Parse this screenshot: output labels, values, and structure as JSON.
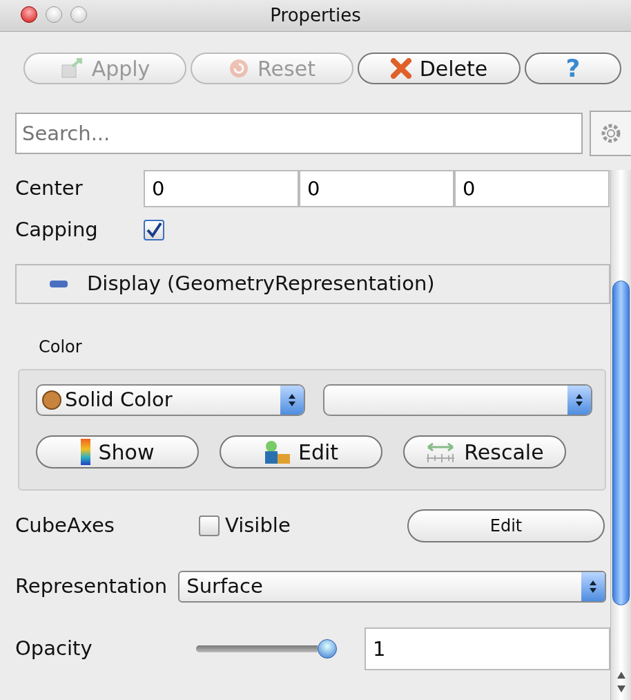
{
  "window": {
    "title": "Properties"
  },
  "toolbar": [
    {
      "label": "Apply",
      "kind": "apply",
      "disabled": true
    },
    {
      "label": "Reset",
      "kind": "reset",
      "disabled": true
    },
    {
      "label": "Delete",
      "kind": "delete",
      "disabled": false
    },
    {
      "label": "?",
      "kind": "help",
      "disabled": false
    }
  ],
  "search": {
    "placeholder": "Search..."
  },
  "center": {
    "label": "Center",
    "values": [
      "0",
      "0",
      "0"
    ]
  },
  "capping": {
    "label": "Capping",
    "checked": true
  },
  "display_section": {
    "title": "Display (GeometryRepresentation)",
    "expanded": true
  },
  "color": {
    "label": "Color",
    "mode": "Solid Color",
    "buttons": [
      {
        "label": "Show",
        "kind": "show"
      },
      {
        "label": "Edit",
        "kind": "edit"
      },
      {
        "label": "Rescale",
        "kind": "rescale"
      }
    ]
  },
  "cube_axes": {
    "label": "CubeAxes",
    "checkbox_label": "Visible",
    "checked": false,
    "button": "Edit"
  },
  "representation": {
    "label": "Representation",
    "value": "Surface"
  },
  "opacity": {
    "label": "Opacity",
    "level": 1,
    "value": "1"
  }
}
